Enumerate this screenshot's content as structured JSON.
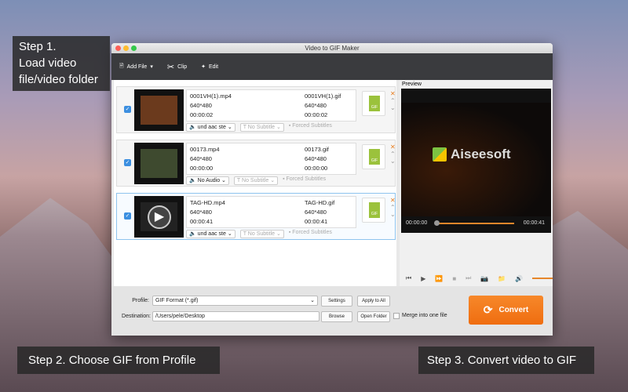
{
  "window": {
    "title": "Video to GIF Maker"
  },
  "toolbar": {
    "add_file": "Add File",
    "clip": "Clip",
    "edit": "Edit"
  },
  "files": [
    {
      "src_name": "0001VH(1).mp4",
      "src_res": "640*480",
      "src_dur": "00:00:02",
      "out_name": "0001VH(1).gif",
      "out_res": "640*480",
      "out_dur": "00:00:02",
      "audio": "und aac ste",
      "subtitle": "No Subtitle",
      "forced": "Forced Subtitles",
      "checked": true
    },
    {
      "src_name": "00173.mp4",
      "src_res": "640*480",
      "src_dur": "00:00:00",
      "out_name": "00173.gif",
      "out_res": "640*480",
      "out_dur": "00:00:00",
      "audio": "No Audio",
      "subtitle": "No Subtitle",
      "forced": "Forced Subtitles",
      "checked": true
    },
    {
      "src_name": "TAG-HD.mp4",
      "src_res": "640*480",
      "src_dur": "00:00:41",
      "out_name": "TAG-HD.gif",
      "out_res": "640*480",
      "out_dur": "00:00:41",
      "audio": "und aac ste",
      "subtitle": "No Subtitle",
      "forced": "Forced Subtitles",
      "checked": true
    }
  ],
  "gif_badge": "GIF",
  "preview": {
    "label": "Preview",
    "brand": "Aiseesoft",
    "time_current": "00:00:00",
    "time_total": "00:00:41",
    "progress": 0,
    "volume": 0.9
  },
  "bottom": {
    "profile_label": "Profile:",
    "profile_value": "GIF Format (*.gif)",
    "settings": "Settings",
    "apply_all": "Apply to All",
    "destination_label": "Destination:",
    "destination_value": "/Users/pele/Desktop",
    "browse": "Browse",
    "open_folder": "Open Folder",
    "merge": "Merge into one file",
    "convert": "Convert"
  },
  "annotations": {
    "step1": "Step 1.\nLoad video\nfile/video folder",
    "step2": "Step 2. Choose GIF from Profile",
    "step3": "Step 3. Convert video to GIF"
  },
  "colors": {
    "accent": "#ef7a1f",
    "toolbar": "#3a3b3e",
    "selection": "#3c8fe0"
  }
}
